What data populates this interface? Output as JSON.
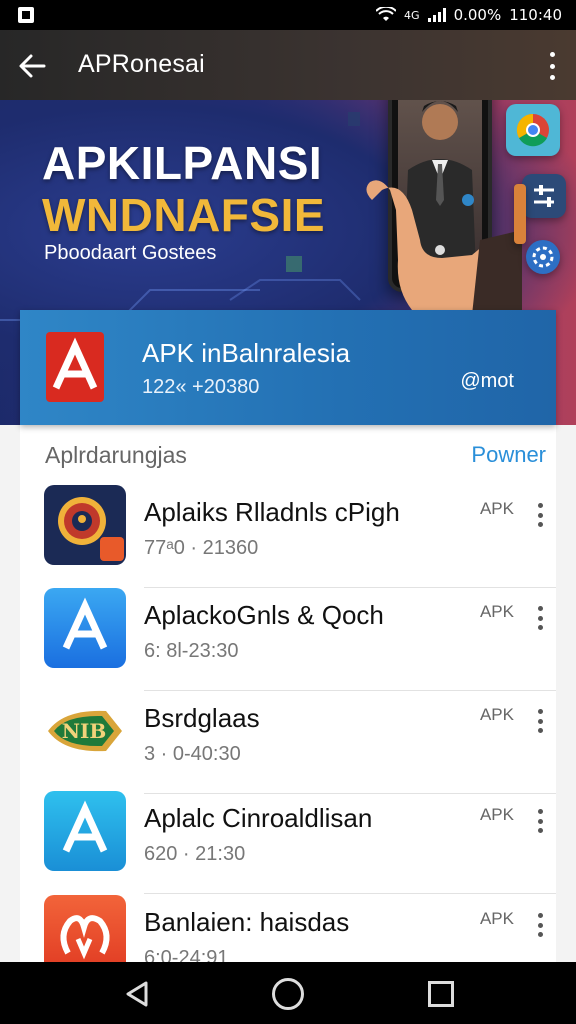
{
  "status_bar": {
    "status_text": "0.00%",
    "time": "110:40",
    "sim_label": "4G"
  },
  "app_bar": {
    "title": "APRonesai"
  },
  "banner": {
    "headline_line1": "APKILPANSI",
    "headline_line2": "WNDNAFSIE",
    "subtitle": "Pboodaart Gostees"
  },
  "featured_card": {
    "logo_letter": "A",
    "title": "APK inBalnralesia",
    "subtitle": "122« +20380",
    "right_label": "@mot"
  },
  "list": {
    "header_title": "Aplrdarungjas",
    "header_link": "Powner",
    "items": [
      {
        "title": "Aplaiks Rlladnls cPigh",
        "subtitle": "77ᵃ0 · 21360",
        "tag": "APK",
        "icon": "shield-badge-icon",
        "icon_badge": "ᵂⁿ",
        "icon_text": ""
      },
      {
        "title": "AplackoGnls & Qoch",
        "subtitle": "6: 8l-23:30",
        "tag": "APK",
        "icon": "app-store-icon",
        "icon_badge": "",
        "icon_text": "A"
      },
      {
        "title": "Bsrdglaas",
        "subtitle": "3 · 0-40:30",
        "tag": "APK",
        "icon": "nib-badge-icon",
        "icon_badge": "",
        "icon_text": "NIB"
      },
      {
        "title": "Aplalc Cinroaldlisan",
        "subtitle": "620 · 21:30",
        "tag": "APK",
        "icon": "app-store-icon",
        "icon_badge": "",
        "icon_text": "A"
      },
      {
        "title": "Banlaien: haisdas",
        "subtitle": "6:0-24:91",
        "tag": "APK",
        "icon": "ribbon-logo-icon",
        "icon_badge": "",
        "icon_text": "ↀ"
      }
    ]
  },
  "colors": {
    "app_bar": "#2d2a29",
    "card_blue": "#2370b3",
    "link_blue": "#2a8fd9",
    "headline_gold": "#f1b83a",
    "logo_red": "#d92a20"
  }
}
